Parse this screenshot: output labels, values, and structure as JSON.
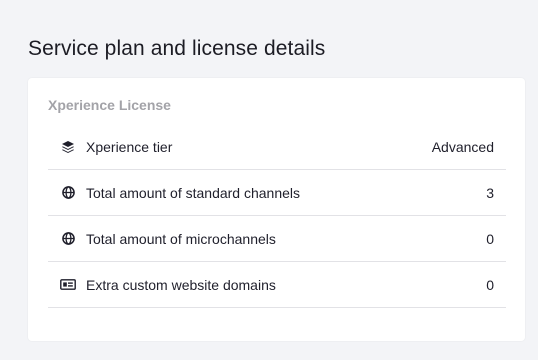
{
  "page": {
    "title": "Service plan and license details"
  },
  "license_card": {
    "title": "Xperience License",
    "rows": [
      {
        "icon": "layers-icon",
        "label": "Xperience tier",
        "value": "Advanced"
      },
      {
        "icon": "globe-icon",
        "label": "Total amount of standard channels",
        "value": "3"
      },
      {
        "icon": "globe-icon",
        "label": "Total amount of microchannels",
        "value": "0"
      },
      {
        "icon": "domain-badge-icon",
        "label": "Extra custom website domains",
        "value": "0"
      }
    ]
  },
  "colors": {
    "page_background": "#f3f4f7",
    "card_background": "#ffffff",
    "card_title": "#a3a3a8",
    "divider": "#e2e2e6",
    "text": "#1f1f2b"
  }
}
